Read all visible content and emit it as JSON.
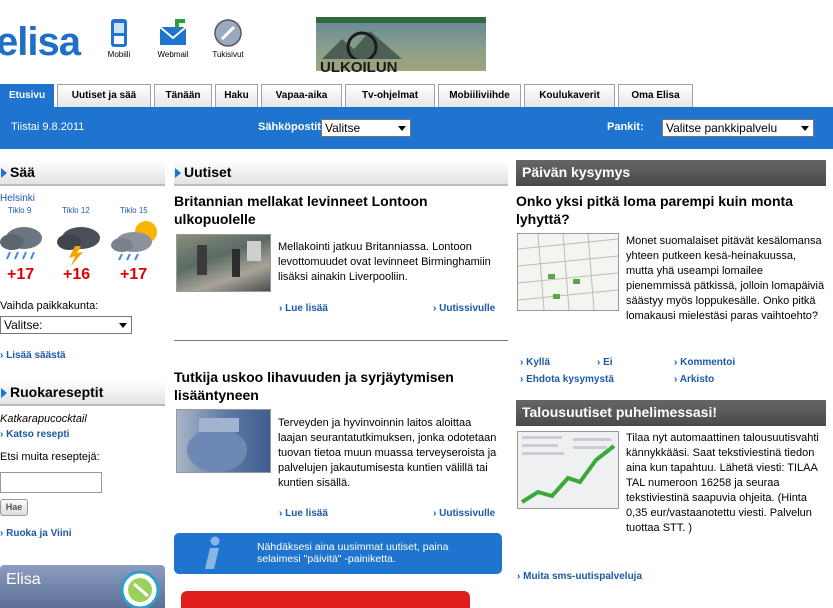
{
  "header": {
    "logo": "elisa",
    "icons": [
      {
        "name": "mobile-icon",
        "label": "Mobiili"
      },
      {
        "name": "webmail-icon",
        "label": "Webmail"
      },
      {
        "name": "support-icon",
        "label": "Tukisivut"
      }
    ],
    "banner": "ULKOILUN"
  },
  "tabs": [
    "Etusivu",
    "Uutiset ja sää",
    "Tänään",
    "Haku",
    "Vapaa-aika",
    "Tv-ohjelmat",
    "Mobiiliviihde",
    "Koulukaverit",
    "Oma Elisa"
  ],
  "bar": {
    "date": "Tiistai 9.8.2011",
    "email_label": "Sähköpostit:",
    "email_value": "Valitse",
    "banks_label": "Pankit:",
    "banks_value": "Valitse pankkipalvelu"
  },
  "weather": {
    "title": "Sää",
    "city": "Helsinki",
    "items": [
      {
        "time": "Tiklo 9",
        "temp": "+17",
        "icon": "rain-cloud-icon"
      },
      {
        "time": "Tiklo 12",
        "temp": "+16",
        "icon": "thunder-cloud-icon"
      },
      {
        "time": "Tiklo 15",
        "temp": "+17",
        "icon": "sun-rain-cloud-icon"
      }
    ],
    "change_label": "Vaihda paikkakunta:",
    "select_value": "Valitse:",
    "more": "Lisää säästä"
  },
  "recipes": {
    "title": "Ruokareseptit",
    "recipe": "Katkarapucocktail",
    "see": "Katso resepti",
    "search_label": "Etsi muita reseptejä:",
    "search_button": "Hae",
    "more": "Ruoka ja Viini"
  },
  "elisa_box": "Elisa",
  "news": {
    "title": "Uutiset",
    "items": [
      {
        "headline": "Britannian mellakat levinneet Lontoon ulkopuolelle",
        "body": "Mellakointi jatkuu Britanniassa. Lontoon levottomuudet ovat levinneet Birminghamiin lisäksi ainakin Liverpooliin.",
        "more": "Lue lisää",
        "archive": "Uutissivulle"
      },
      {
        "headline": "Tutkija uskoo lihavuuden ja syrjäytymisen lisääntyneen",
        "body": "Terveyden ja hyvinvoinnin laitos aloittaa laajan seurantatutkimuksen, jonka odotetaan tuovan tietoa muun muassa terveyseroista ja palvelujen jakautumisesta kuntien välillä tai kuntien sisällä.",
        "more": "Lue lisää",
        "archive": "Uutissivulle"
      }
    ],
    "info": "Nähdäksesi aina uusimmat uutiset, paina selaimesi \"päivitä\" -painiketta."
  },
  "poll": {
    "title": "Päivän kysymys",
    "question": "Onko yksi pitkä loma parempi kuin monta lyhyttä?",
    "body": "Monet suomalaiset pitävät kesälomansa yhteen putkeen kesä-heinakuussa, mutta yhä useampi lomailee pienemmissä pätkissä, jolloin lomapäiviä säästyy myös loppukesälle. Onko pitkä lomakausi mielestäsi paras vaihtoehto?",
    "links": [
      "Kyllä",
      "Ei",
      "Kommentoi",
      "Ehdota kysymystä",
      "Arkisto"
    ]
  },
  "finance": {
    "title": "Talousuutiset puhelimessasi!",
    "body": "Tilaa nyt automaattinen talousuutisvahti kännykkääsi. Saat tekstiviestinä tiedon aina kun tapahtuu. Lähetä viesti: TILAA TAL numeroon 16258 ja seuraa tekstiviestinä saapuvia ohjeita. (Hinta 0,35 eur/vastaanotettu viesti. Palvelun tuottaa STT. )",
    "more": "Muita sms-uutispalveluja"
  }
}
